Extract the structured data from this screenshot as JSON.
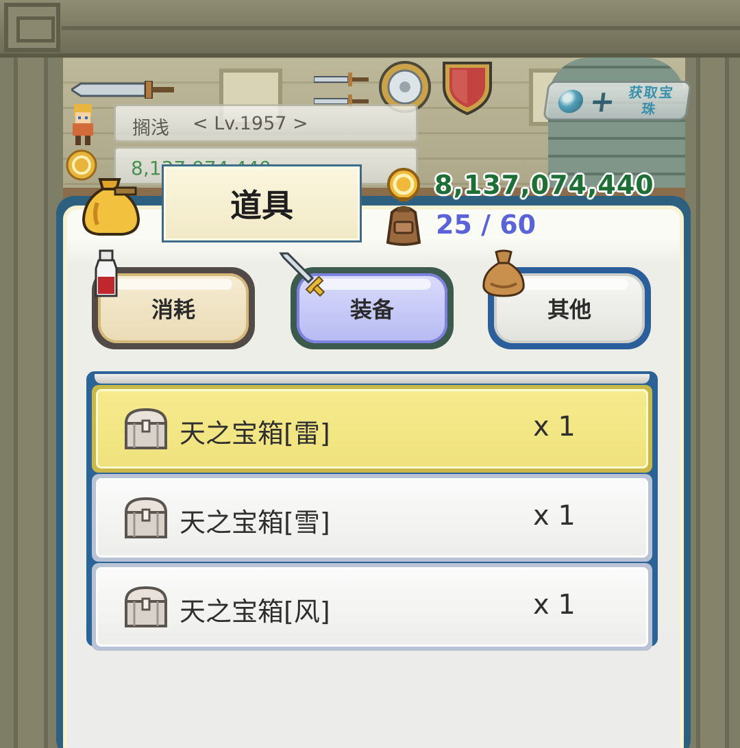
{
  "player": {
    "name": "搁浅",
    "level": "< Lv.1957 >",
    "gold_partial": "8,137,074,440"
  },
  "gem_button": {
    "label": "获取宝珠"
  },
  "inventory": {
    "title": "道具",
    "gold": "8,137,074,440",
    "capacity": "25 / 60"
  },
  "tabs": [
    {
      "label": "消耗",
      "icon": "potion-icon",
      "state": "default"
    },
    {
      "label": "装备",
      "icon": "sword-icon",
      "state": "active"
    },
    {
      "label": "其他",
      "icon": "pouch-icon",
      "state": "default"
    }
  ],
  "items": [
    {
      "name": "天之宝箱[雷]",
      "qty": "x 1",
      "icon": "treasure-chest-icon",
      "selected": true
    },
    {
      "name": "天之宝箱[雪]",
      "qty": "x 1",
      "icon": "treasure-chest-icon",
      "selected": false
    },
    {
      "name": "天之宝箱[风]",
      "qty": "x 1",
      "icon": "treasure-chest-icon",
      "selected": false
    }
  ],
  "colors": {
    "panel_frame": "#2d5f7f",
    "gold_text": "#1d6f36",
    "capacity_text": "#5a63d8",
    "selected_row": "#f6ea8e"
  }
}
